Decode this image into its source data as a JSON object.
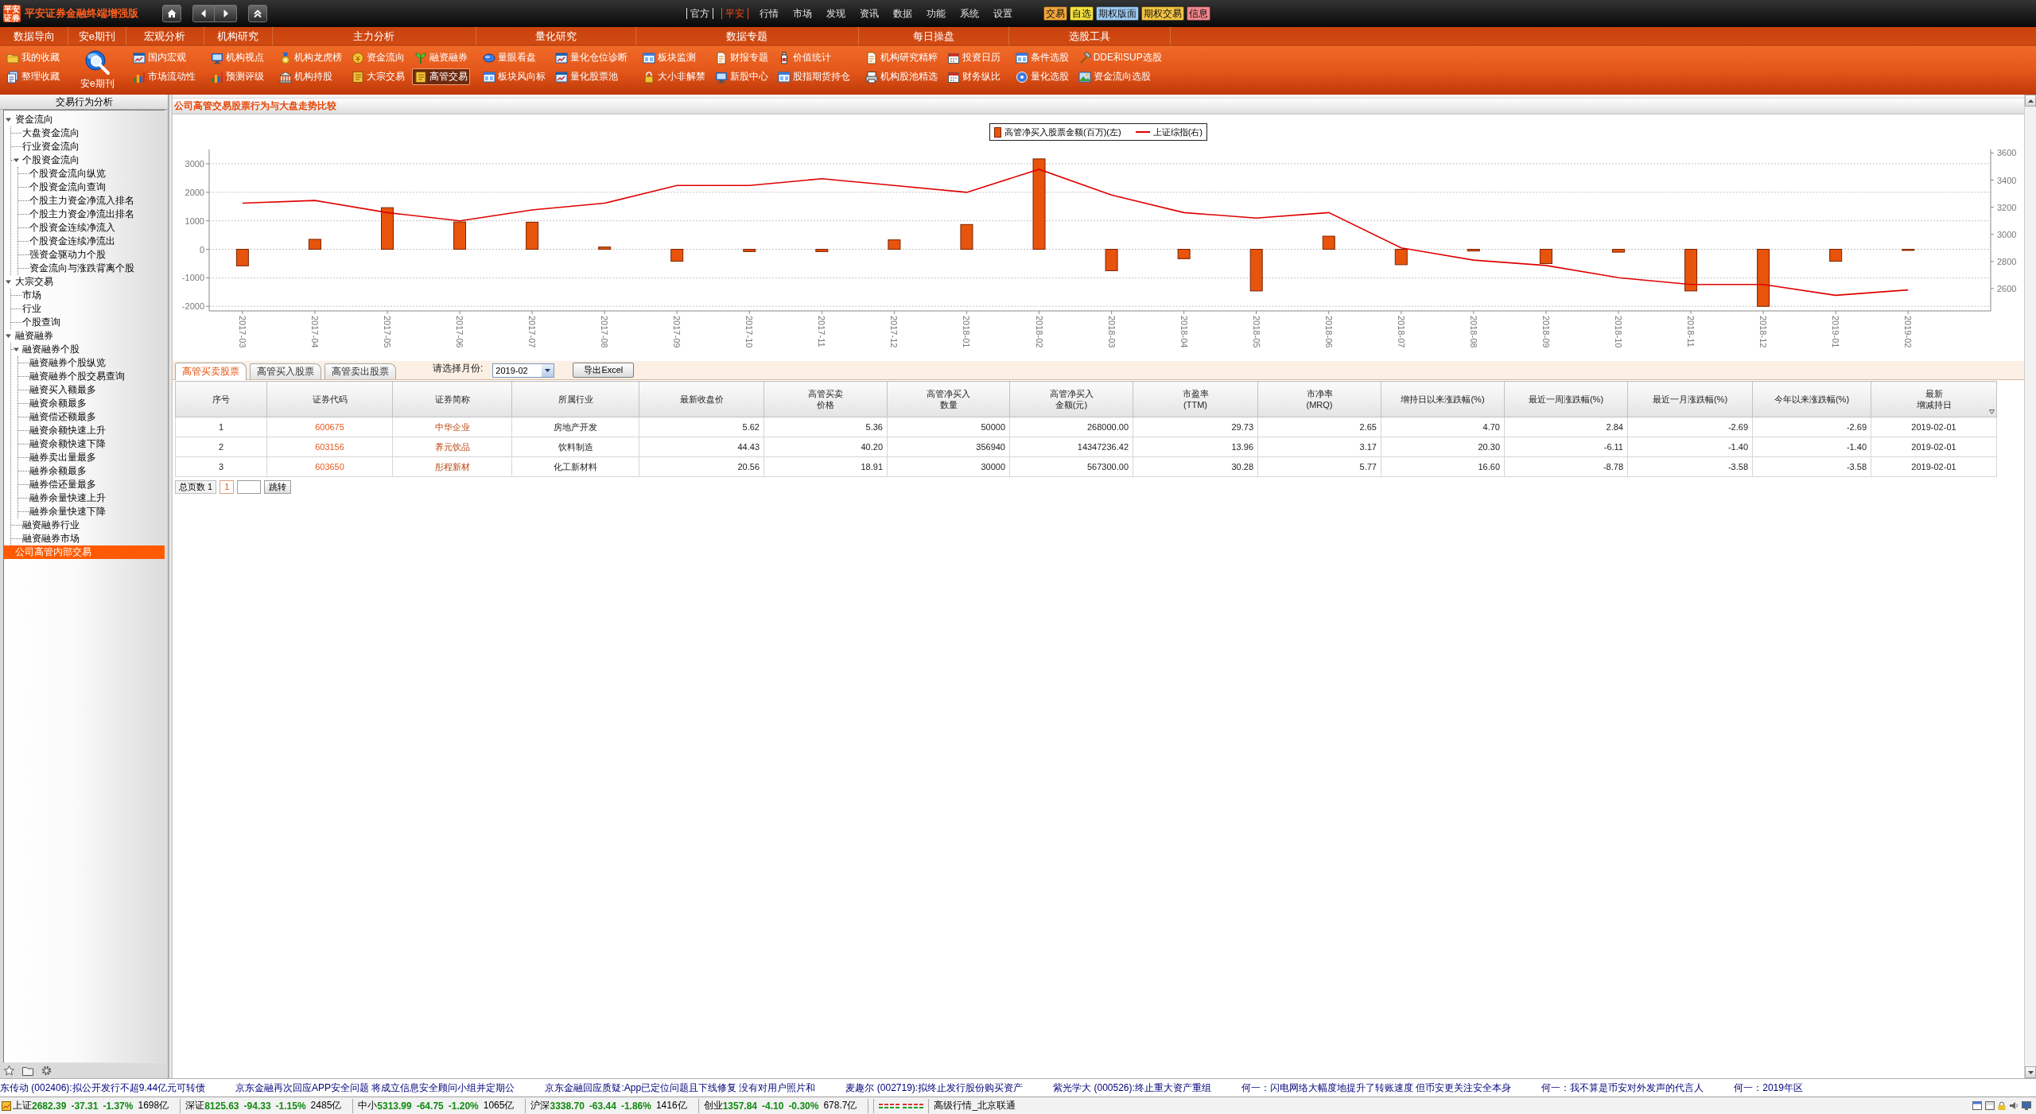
{
  "top_bar": {
    "logo_text": "平安证券",
    "title": "平安证券金融终端增强版",
    "menu": [
      {
        "label": "官方",
        "kind": "framed",
        "selected": false
      },
      {
        "label": "平安",
        "kind": "framed",
        "selected": true
      },
      {
        "label": "行情",
        "kind": "plain",
        "selected": false
      },
      {
        "label": "市场",
        "kind": "plain",
        "selected": false
      },
      {
        "label": "发现",
        "kind": "plain",
        "selected": false
      },
      {
        "label": "资讯",
        "kind": "plain",
        "selected": false
      },
      {
        "label": "数据",
        "kind": "plain",
        "selected": false
      },
      {
        "label": "功能",
        "kind": "plain",
        "selected": false
      },
      {
        "label": "系统",
        "kind": "plain",
        "selected": false
      },
      {
        "label": "设置",
        "kind": "plain",
        "selected": false
      }
    ],
    "badges": [
      {
        "label": "交易",
        "color": "#f2a63a"
      },
      {
        "label": "自选",
        "color": "#f4e23c"
      },
      {
        "label": "期权版面",
        "color": "#9ccaf2"
      },
      {
        "label": "期权交易",
        "color": "#f2c443"
      },
      {
        "label": "信息",
        "color": "#f2868c"
      }
    ]
  },
  "toolbar": {
    "groups": [
      {
        "title": "数据导向",
        "kind": "grid",
        "items": [
          {
            "label": "我的收藏",
            "selected": false
          },
          {
            "label": "整理收藏",
            "selected": false
          }
        ]
      },
      {
        "title": "安e期刊",
        "kind": "large",
        "items": [
          {
            "label": "安e期刊",
            "selected": false
          }
        ]
      },
      {
        "title": "宏观分析",
        "kind": "grid",
        "items": [
          {
            "label": "国内宏观",
            "selected": false
          },
          {
            "label": "市场流动性",
            "selected": false
          }
        ]
      },
      {
        "title": "机构研究",
        "kind": "grid",
        "items": [
          {
            "label": "机构视点",
            "selected": false
          },
          {
            "label": "预测评级",
            "selected": false
          }
        ]
      },
      {
        "title": "主力分析",
        "kind": "grid",
        "items": [
          {
            "label": "机构龙虎榜",
            "selected": false
          },
          {
            "label": "资金流向",
            "selected": false
          },
          {
            "label": "融资融券",
            "selected": false
          },
          {
            "label": "机构持股",
            "selected": false
          },
          {
            "label": "大宗交易",
            "selected": false
          },
          {
            "label": "高管交易",
            "selected": true
          }
        ]
      },
      {
        "title": "量化研究",
        "kind": "grid",
        "items": [
          {
            "label": "量眼看盘",
            "selected": false
          },
          {
            "label": "量化仓位诊断",
            "selected": false
          },
          {
            "label": "板块风向标",
            "selected": false
          },
          {
            "label": "量化股票池",
            "selected": false
          }
        ]
      },
      {
        "title": "数据专题",
        "kind": "grid",
        "items": [
          {
            "label": "板块监测",
            "selected": false
          },
          {
            "label": "财报专题",
            "selected": false
          },
          {
            "label": "价值统计",
            "selected": false
          },
          {
            "label": "大小非解禁",
            "selected": false
          },
          {
            "label": "新股中心",
            "selected": false
          },
          {
            "label": "股指期货持仓",
            "selected": false
          }
        ]
      },
      {
        "title": "每日操盘",
        "kind": "grid",
        "items": [
          {
            "label": "机构研究精粹",
            "selected": false
          },
          {
            "label": "投资日历",
            "selected": false
          },
          {
            "label": "机构股池精选",
            "selected": false
          },
          {
            "label": "财务纵比",
            "selected": false
          }
        ]
      },
      {
        "title": "选股工具",
        "kind": "grid",
        "items": [
          {
            "label": "条件选股",
            "selected": false
          },
          {
            "label": "DDE和SUP选股",
            "selected": false
          },
          {
            "label": "量化选股",
            "selected": false
          },
          {
            "label": "资金流向选股",
            "selected": false
          }
        ]
      }
    ]
  },
  "sidebar": {
    "title": "交易行为分析",
    "tree": [
      {
        "label": "资金流向",
        "selected": false,
        "expanded": true,
        "children": [
          {
            "label": "大盘资金流向",
            "selected": false
          },
          {
            "label": "行业资金流向",
            "selected": false
          },
          {
            "label": "个股资金流向",
            "selected": false,
            "expanded": true,
            "children": [
              {
                "label": "个股资金流向纵览",
                "selected": false
              },
              {
                "label": "个股资金流向查询",
                "selected": false
              },
              {
                "label": "个股主力资金净流入排名",
                "selected": false
              },
              {
                "label": "个股主力资金净流出排名",
                "selected": false
              },
              {
                "label": "个股资金连续净流入",
                "selected": false
              },
              {
                "label": "个股资金连续净流出",
                "selected": false
              },
              {
                "label": "强资金驱动力个股",
                "selected": false
              },
              {
                "label": "资金流向与涨跌背离个股",
                "selected": false
              }
            ]
          }
        ]
      },
      {
        "label": "大宗交易",
        "selected": false,
        "expanded": true,
        "children": [
          {
            "label": "市场",
            "selected": false
          },
          {
            "label": "行业",
            "selected": false
          },
          {
            "label": "个股查询",
            "selected": false
          }
        ]
      },
      {
        "label": "融资融券",
        "selected": false,
        "expanded": true,
        "children": [
          {
            "label": "融资融券个股",
            "selected": false,
            "expanded": true,
            "children": [
              {
                "label": "融资融券个股纵览",
                "selected": false
              },
              {
                "label": "融资融券个股交易查询",
                "selected": false
              },
              {
                "label": "融资买入额最多",
                "selected": false
              },
              {
                "label": "融资余额最多",
                "selected": false
              },
              {
                "label": "融资偿还额最多",
                "selected": false
              },
              {
                "label": "融资余额快速上升",
                "selected": false
              },
              {
                "label": "融资余额快速下降",
                "selected": false
              },
              {
                "label": "融券卖出量最多",
                "selected": false
              },
              {
                "label": "融券余额最多",
                "selected": false
              },
              {
                "label": "融券偿还量最多",
                "selected": false
              },
              {
                "label": "融券余量快速上升",
                "selected": false
              },
              {
                "label": "融券余量快速下降",
                "selected": false
              }
            ]
          },
          {
            "label": "融资融券行业",
            "selected": false
          },
          {
            "label": "融资融券市场",
            "selected": false
          }
        ]
      },
      {
        "label": "公司高管内部交易",
        "selected": true
      }
    ]
  },
  "panel": {
    "title": "公司高管交易股票行为与大盘走势比较",
    "chart_data": {
      "type": "bar",
      "categories": [
        "2017-03",
        "2017-04",
        "2017-05",
        "2017-06",
        "2017-07",
        "2017-08",
        "2017-09",
        "2017-10",
        "2017-11",
        "2017-12",
        "2018-01",
        "2018-02",
        "2018-03",
        "2018-04",
        "2018-05",
        "2018-06",
        "2018-07",
        "2018-08",
        "2018-09",
        "2018-10",
        "2018-11",
        "2018-12",
        "2019-01",
        "2019-02"
      ],
      "series": [
        {
          "name": "高管净买入股票金额(百万)(左)",
          "type": "bar",
          "color": "#e8540c",
          "values": [
            -580,
            350,
            1460,
            960,
            950,
            80,
            -420,
            -80,
            -80,
            330,
            870,
            3170,
            -750,
            -330,
            -1460,
            460,
            -540,
            -60,
            -500,
            -100,
            -1460,
            -2000,
            -420,
            -40
          ]
        },
        {
          "name": "上证综指(右)",
          "type": "line",
          "axis": "y2",
          "color": "#e00000",
          "values": [
            3230,
            3250,
            3160,
            3100,
            3180,
            3230,
            3360,
            3360,
            3410,
            3360,
            3310,
            3480,
            3290,
            3160,
            3120,
            3160,
            2900,
            2810,
            2770,
            2680,
            2630,
            2630,
            2550,
            2590
          ]
        }
      ],
      "legend": "top",
      "grid": true,
      "ylim": [
        -2160,
        3500
      ],
      "yticks": [
        -2000,
        -1000,
        0,
        1000,
        2000,
        3000
      ],
      "y2lim": [
        2435,
        3626
      ],
      "y2ticks": [
        2600,
        2800,
        3000,
        3200,
        3400,
        3600
      ]
    }
  },
  "table_view": {
    "tabs": [
      {
        "label": "高管买卖股票",
        "selected": true
      },
      {
        "label": "高管买入股票",
        "selected": false
      },
      {
        "label": "高管卖出股票",
        "selected": false
      }
    ],
    "month_label": "请选择月份:",
    "month_select": {
      "value": "2019-02"
    },
    "export_button": "导出Excel",
    "columns": [
      {
        "label": "序号",
        "kind": "index",
        "sorted": false
      },
      {
        "label": "证券代码",
        "kind": "code",
        "sorted": false
      },
      {
        "label": "证券简称",
        "kind": "name",
        "sorted": false
      },
      {
        "label": "所属行业",
        "kind": "text",
        "sorted": false
      },
      {
        "label": "最新收盘价",
        "kind": "number",
        "sorted": false
      },
      {
        "label": [
          "高管买卖",
          "价格"
        ],
        "kind": "number",
        "sorted": false
      },
      {
        "label": [
          "高管净买入",
          "数量"
        ],
        "kind": "number",
        "sorted": false
      },
      {
        "label": [
          "高管净买入",
          "金额(元)"
        ],
        "kind": "number",
        "sorted": false
      },
      {
        "label": [
          "市盈率",
          "(TTM)"
        ],
        "kind": "number",
        "sorted": false
      },
      {
        "label": [
          "市净率",
          "(MRQ)"
        ],
        "kind": "number",
        "sorted": false
      },
      {
        "label": "增持日以来涨跌幅(%)",
        "kind": "number",
        "sorted": false
      },
      {
        "label": "最近一周涨跌幅(%)",
        "kind": "number",
        "sorted": false
      },
      {
        "label": "最近一月涨跌幅(%)",
        "kind": "number",
        "sorted": false
      },
      {
        "label": "今年以来涨跌幅(%)",
        "kind": "number",
        "sorted": false
      },
      {
        "label": [
          "最新",
          "增减持日"
        ],
        "kind": "date",
        "sorted": true
      }
    ],
    "rows": [
      [
        "1",
        "600675",
        "中华企业",
        "房地产开发",
        "5.62",
        "5.36",
        "50000",
        "268000.00",
        "29.73",
        "2.65",
        "4.70",
        "2.84",
        "-2.69",
        "-2.69",
        "2019-02-01"
      ],
      [
        "2",
        "603156",
        "养元饮品",
        "饮料制造",
        "44.43",
        "40.20",
        "356940",
        "14347236.42",
        "13.96",
        "3.17",
        "20.30",
        "-6.11",
        "-1.40",
        "-1.40",
        "2019-02-01"
      ],
      [
        "3",
        "603650",
        "彤程新材",
        "化工新材料",
        "20.56",
        "18.91",
        "30000",
        "567300.00",
        "30.28",
        "5.77",
        "16.60",
        "-8.78",
        "-3.58",
        "-3.58",
        "2019-02-01"
      ]
    ],
    "pager": {
      "page_count": "总页数 1",
      "current_page": "1",
      "jump_button": "跳转"
    }
  },
  "news_ticker": {
    "items": [
      "东传动 (002406):拟公开发行不超9.44亿元可转债",
      "京东金融再次回应APP安全问题 将成立信息安全顾问小组并定期公",
      "京东金融回应质疑:App已定位问题且下线修复 没有对用户照片和",
      "麦趣尔 (002719):拟终止发行股份购买资产",
      "紫光学大 (000526):终止重大资产重组",
      "何一：闪电网络大幅度地提升了转账速度 但币安更关注安全本身",
      "何一：我不算是币安对外发声的代言人",
      "何一：2019年区"
    ]
  },
  "status_bar": {
    "indices": [
      {
        "name": "上证",
        "value": "2682.39",
        "change": "-37.31",
        "percent": "-1.37%",
        "volume": "1698亿"
      },
      {
        "name": "深证",
        "value": "8125.63",
        "change": "-94.33",
        "percent": "-1.15%",
        "volume": "2485亿"
      },
      {
        "name": "中小",
        "value": "5313.99",
        "change": "-64.75",
        "percent": "-1.20%",
        "volume": "1065亿"
      },
      {
        "name": "沪深",
        "value": "3338.70",
        "change": "-63.44",
        "percent": "-1.86%",
        "volume": "1416亿"
      },
      {
        "name": "创业",
        "value": "1357.84",
        "change": "-4.10",
        "percent": "-0.30%",
        "volume": "678.7亿"
      }
    ],
    "feed": "高级行情_北京联通"
  }
}
